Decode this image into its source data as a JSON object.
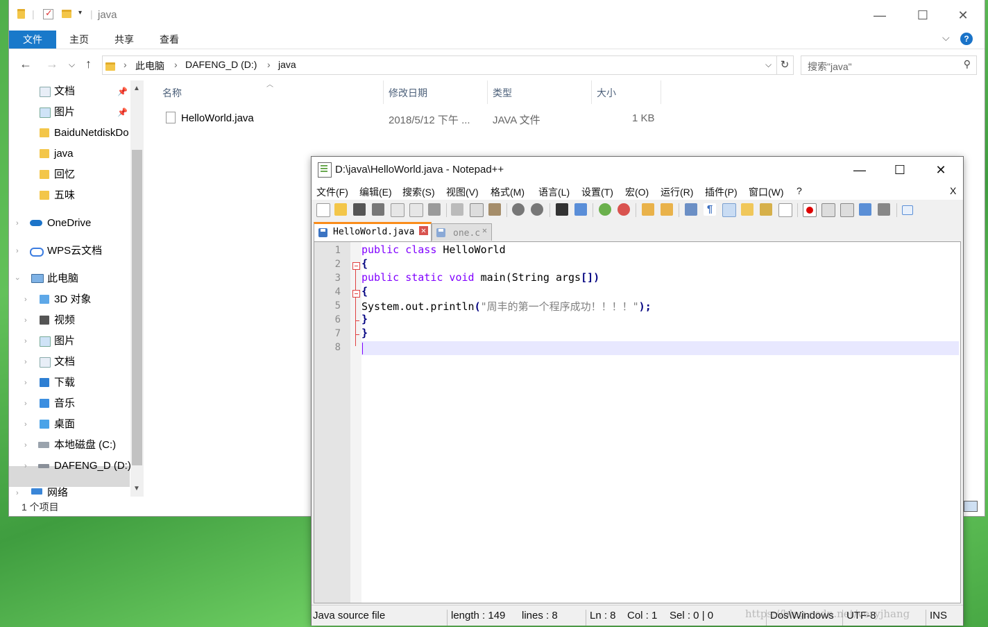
{
  "explorer": {
    "title": "java",
    "ribbon": {
      "file": "文件",
      "home": "主页",
      "share": "共享",
      "view": "查看"
    },
    "help": "?",
    "address": {
      "pc": "此电脑",
      "drive": "DAFENG_D (D:)",
      "folder": "java"
    },
    "search_placeholder": "搜索\"java\"",
    "nav": {
      "quick": [
        "文档",
        "图片",
        "BaiduNetdiskDo",
        "java",
        "回忆",
        "五味"
      ],
      "onedrive": "OneDrive",
      "wps": "WPS云文档",
      "pc": "此电脑",
      "pc_items": [
        "3D 对象",
        "视频",
        "图片",
        "文档",
        "下载",
        "音乐",
        "桌面",
        "本地磁盘 (C:)",
        "DAFENG_D (D:)"
      ],
      "network": "网络"
    },
    "columns": {
      "name": "名称",
      "date": "修改日期",
      "type": "类型",
      "size": "大小"
    },
    "files": [
      {
        "name": "HelloWorld.java",
        "date": "2018/5/12 下午 ...",
        "type": "JAVA 文件",
        "size": "1 KB"
      }
    ],
    "status": "1 个项目"
  },
  "npp": {
    "title": "D:\\java\\HelloWorld.java - Notepad++",
    "menu": [
      "文件(F)",
      "编辑(E)",
      "搜索(S)",
      "视图(V)",
      "格式(M)",
      "语言(L)",
      "设置(T)",
      "宏(O)",
      "运行(R)",
      "插件(P)",
      "窗口(W)",
      "?"
    ],
    "menu_close": "X",
    "tabs": [
      {
        "label": "HelloWorld.java",
        "active": true
      },
      {
        "label": "one.c",
        "active": false
      }
    ],
    "line_numbers": [
      "1",
      "2",
      "3",
      "4",
      "5",
      "6",
      "7",
      "8"
    ],
    "code": {
      "l1_kw": "public class ",
      "l1_rest": "HelloWorld",
      "l2": "{",
      "l3_kw": "public static void ",
      "l3_rest": "main(String args",
      "l3_op": "[])",
      "l4": "{",
      "l5_a": "System.out.println",
      "l5_op1": "(",
      "l5_str": "\"周丰的第一个程序成功！！！！\"",
      "l5_op2": ");",
      "l6": "}",
      "l7": "}"
    },
    "status": {
      "type": "Java source file",
      "length": "length : 149",
      "lines": "lines : 8",
      "ln": "Ln : 8",
      "col": "Col : 1",
      "sel": "Sel : 0 | 0",
      "eol": "Dos\\Windows",
      "enc": "UTF-8",
      "mode": "INS"
    }
  },
  "watermark": "https://blog.csdn.net/veryjhang"
}
